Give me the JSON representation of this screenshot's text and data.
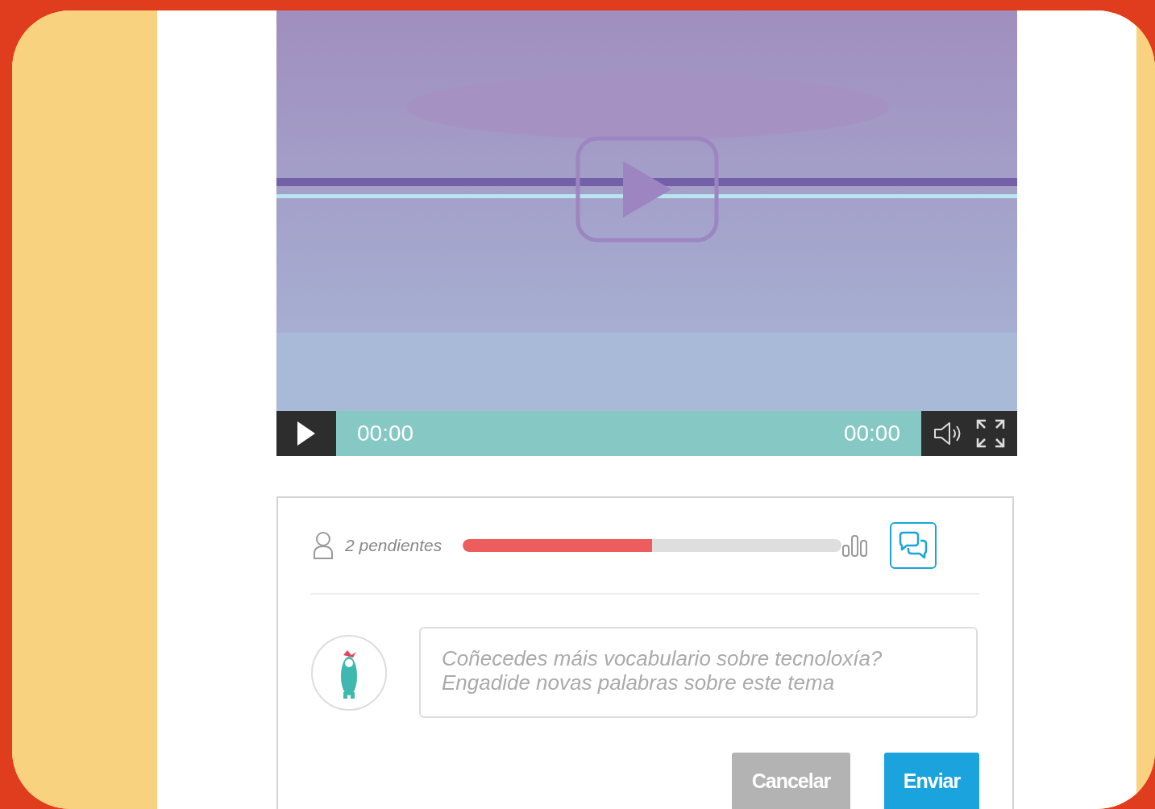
{
  "video": {
    "kind": "picture",
    "current_time": "00:00",
    "duration": "00:00"
  },
  "progress": {
    "pending_label": "2 pendientes",
    "level": 0.5
  },
  "comment": {
    "placeholder": "Coñecedes máis vocabulario sobre tecnoloxía?\nEngadide novas palabras sobre este tema"
  },
  "buttons": [
    {
      "label": "Cancelar",
      "kind": "cancel"
    },
    {
      "label": "Enviar",
      "kind": "submit"
    }
  ]
}
